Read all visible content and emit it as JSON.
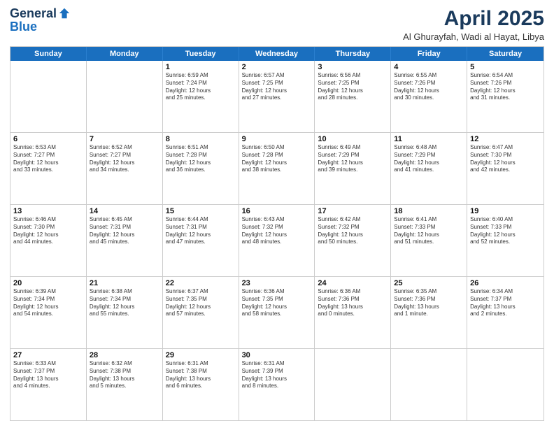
{
  "header": {
    "logo_general": "General",
    "logo_blue": "Blue",
    "month_title": "April 2025",
    "subtitle": "Al Ghurayfah, Wadi al Hayat, Libya"
  },
  "weekdays": [
    "Sunday",
    "Monday",
    "Tuesday",
    "Wednesday",
    "Thursday",
    "Friday",
    "Saturday"
  ],
  "rows": [
    [
      {
        "day": "",
        "detail": ""
      },
      {
        "day": "",
        "detail": ""
      },
      {
        "day": "1",
        "detail": "Sunrise: 6:59 AM\nSunset: 7:24 PM\nDaylight: 12 hours\nand 25 minutes."
      },
      {
        "day": "2",
        "detail": "Sunrise: 6:57 AM\nSunset: 7:25 PM\nDaylight: 12 hours\nand 27 minutes."
      },
      {
        "day": "3",
        "detail": "Sunrise: 6:56 AM\nSunset: 7:25 PM\nDaylight: 12 hours\nand 28 minutes."
      },
      {
        "day": "4",
        "detail": "Sunrise: 6:55 AM\nSunset: 7:26 PM\nDaylight: 12 hours\nand 30 minutes."
      },
      {
        "day": "5",
        "detail": "Sunrise: 6:54 AM\nSunset: 7:26 PM\nDaylight: 12 hours\nand 31 minutes."
      }
    ],
    [
      {
        "day": "6",
        "detail": "Sunrise: 6:53 AM\nSunset: 7:27 PM\nDaylight: 12 hours\nand 33 minutes."
      },
      {
        "day": "7",
        "detail": "Sunrise: 6:52 AM\nSunset: 7:27 PM\nDaylight: 12 hours\nand 34 minutes."
      },
      {
        "day": "8",
        "detail": "Sunrise: 6:51 AM\nSunset: 7:28 PM\nDaylight: 12 hours\nand 36 minutes."
      },
      {
        "day": "9",
        "detail": "Sunrise: 6:50 AM\nSunset: 7:28 PM\nDaylight: 12 hours\nand 38 minutes."
      },
      {
        "day": "10",
        "detail": "Sunrise: 6:49 AM\nSunset: 7:29 PM\nDaylight: 12 hours\nand 39 minutes."
      },
      {
        "day": "11",
        "detail": "Sunrise: 6:48 AM\nSunset: 7:29 PM\nDaylight: 12 hours\nand 41 minutes."
      },
      {
        "day": "12",
        "detail": "Sunrise: 6:47 AM\nSunset: 7:30 PM\nDaylight: 12 hours\nand 42 minutes."
      }
    ],
    [
      {
        "day": "13",
        "detail": "Sunrise: 6:46 AM\nSunset: 7:30 PM\nDaylight: 12 hours\nand 44 minutes."
      },
      {
        "day": "14",
        "detail": "Sunrise: 6:45 AM\nSunset: 7:31 PM\nDaylight: 12 hours\nand 45 minutes."
      },
      {
        "day": "15",
        "detail": "Sunrise: 6:44 AM\nSunset: 7:31 PM\nDaylight: 12 hours\nand 47 minutes."
      },
      {
        "day": "16",
        "detail": "Sunrise: 6:43 AM\nSunset: 7:32 PM\nDaylight: 12 hours\nand 48 minutes."
      },
      {
        "day": "17",
        "detail": "Sunrise: 6:42 AM\nSunset: 7:32 PM\nDaylight: 12 hours\nand 50 minutes."
      },
      {
        "day": "18",
        "detail": "Sunrise: 6:41 AM\nSunset: 7:33 PM\nDaylight: 12 hours\nand 51 minutes."
      },
      {
        "day": "19",
        "detail": "Sunrise: 6:40 AM\nSunset: 7:33 PM\nDaylight: 12 hours\nand 52 minutes."
      }
    ],
    [
      {
        "day": "20",
        "detail": "Sunrise: 6:39 AM\nSunset: 7:34 PM\nDaylight: 12 hours\nand 54 minutes."
      },
      {
        "day": "21",
        "detail": "Sunrise: 6:38 AM\nSunset: 7:34 PM\nDaylight: 12 hours\nand 55 minutes."
      },
      {
        "day": "22",
        "detail": "Sunrise: 6:37 AM\nSunset: 7:35 PM\nDaylight: 12 hours\nand 57 minutes."
      },
      {
        "day": "23",
        "detail": "Sunrise: 6:36 AM\nSunset: 7:35 PM\nDaylight: 12 hours\nand 58 minutes."
      },
      {
        "day": "24",
        "detail": "Sunrise: 6:36 AM\nSunset: 7:36 PM\nDaylight: 13 hours\nand 0 minutes."
      },
      {
        "day": "25",
        "detail": "Sunrise: 6:35 AM\nSunset: 7:36 PM\nDaylight: 13 hours\nand 1 minute."
      },
      {
        "day": "26",
        "detail": "Sunrise: 6:34 AM\nSunset: 7:37 PM\nDaylight: 13 hours\nand 2 minutes."
      }
    ],
    [
      {
        "day": "27",
        "detail": "Sunrise: 6:33 AM\nSunset: 7:37 PM\nDaylight: 13 hours\nand 4 minutes."
      },
      {
        "day": "28",
        "detail": "Sunrise: 6:32 AM\nSunset: 7:38 PM\nDaylight: 13 hours\nand 5 minutes."
      },
      {
        "day": "29",
        "detail": "Sunrise: 6:31 AM\nSunset: 7:38 PM\nDaylight: 13 hours\nand 6 minutes."
      },
      {
        "day": "30",
        "detail": "Sunrise: 6:31 AM\nSunset: 7:39 PM\nDaylight: 13 hours\nand 8 minutes."
      },
      {
        "day": "",
        "detail": ""
      },
      {
        "day": "",
        "detail": ""
      },
      {
        "day": "",
        "detail": ""
      }
    ]
  ]
}
